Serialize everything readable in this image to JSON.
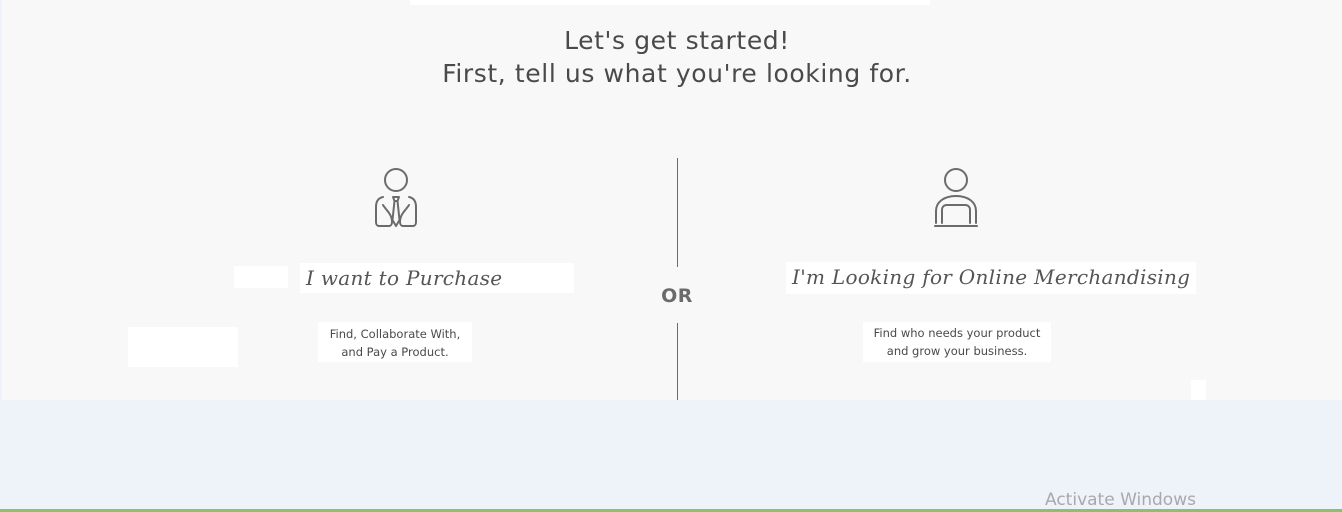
{
  "heading": {
    "line1": "Let's get started!",
    "line2": "First, tell us what you're looking for."
  },
  "divider": {
    "label": "OR"
  },
  "options": [
    {
      "icon": "businessman-icon",
      "title": "I want to Purchase",
      "description_line1": "Find, Collaborate With,",
      "description_line2": "and Pay a Product."
    },
    {
      "icon": "person-laptop-icon",
      "title": "I'm Looking for Online Merchandising",
      "description_line1": "Find who needs your product",
      "description_line2": "and grow your business."
    }
  ],
  "watermark": {
    "text": "Activate Windows"
  },
  "colors": {
    "panel_background": "#f8f8f8",
    "page_background": "#eef2f9",
    "text": "#4a4a4a",
    "icon_stroke": "#6b6b6b",
    "bottom_accent": "#8dc06a"
  }
}
